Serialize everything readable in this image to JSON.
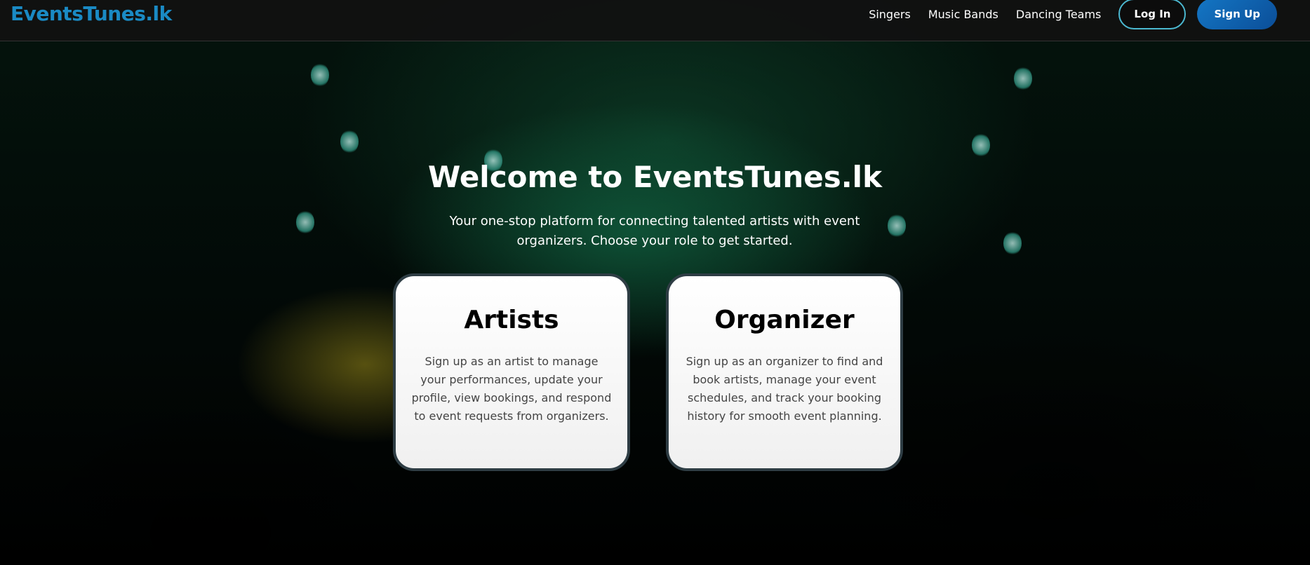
{
  "nav": {
    "logo": "EventsTunes.lk",
    "links": [
      "Singers",
      "Music Bands",
      "Dancing Teams"
    ],
    "login": "Log In",
    "signup": "Sign Up"
  },
  "hero": {
    "title": "Welcome to EventsTunes.lk",
    "subtitle": "Your one-stop platform for connecting talented artists with event organizers. Choose your role to get started."
  },
  "cards": [
    {
      "title": "Artists",
      "text": "Sign up as an artist to manage your performances, update your profile, view bookings, and respond to event requests from organizers."
    },
    {
      "title": "Organizer",
      "text": "Sign up as an organizer to find and book artists, manage your event schedules, and track your booking history for smooth event planning."
    }
  ],
  "colors": {
    "brand": "#1a8ac4",
    "signup": "#1476c4",
    "login_border": "#4bb8d0"
  }
}
